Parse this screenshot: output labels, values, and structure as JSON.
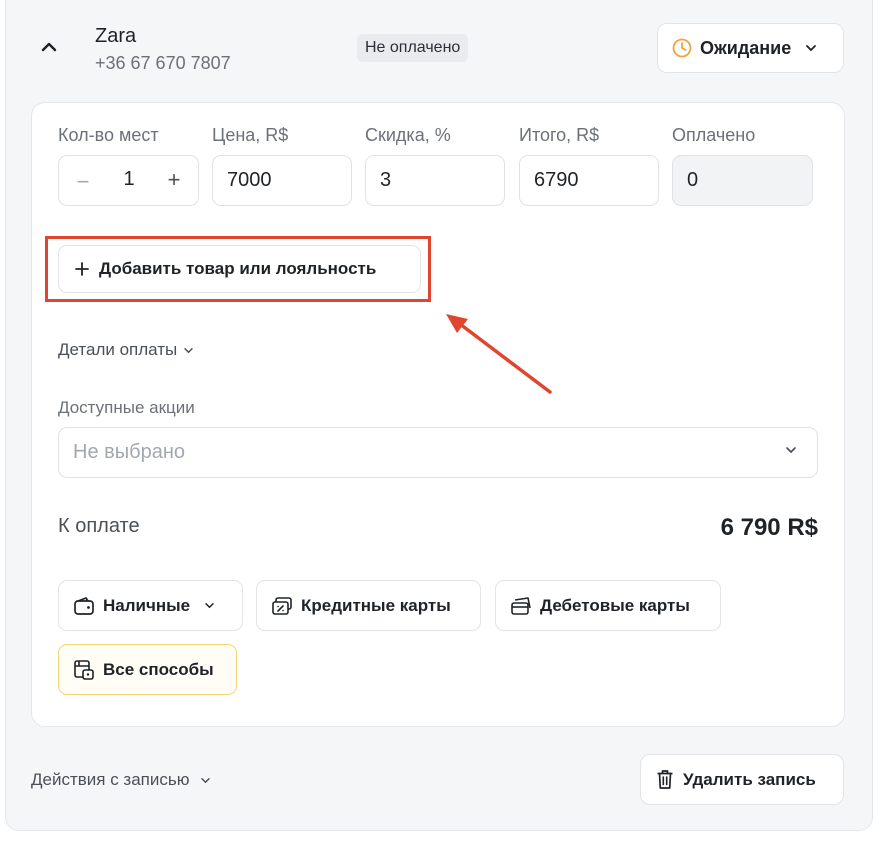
{
  "client": {
    "name": "Zara",
    "phone": "+36 67 670 7807",
    "payment_badge": "Не оплачено",
    "status": "Ожидание",
    "status_icon": "clock-icon",
    "status_color": "#f2a23a"
  },
  "fields": {
    "seats_label": "Кол-во мест",
    "seats_value": "1",
    "price_label": "Цена, R$",
    "price_value": "7000",
    "discount_label": "Скидка, %",
    "discount_value": "3",
    "total_label": "Итого, R$",
    "total_value": "6790",
    "paid_label": "Оплачено",
    "paid_value": "0"
  },
  "add_item": {
    "label": "Добавить товар или лояльность"
  },
  "payment_details": {
    "label": "Детали оплаты"
  },
  "promotions": {
    "label": "Доступные акции",
    "placeholder": "Не выбрано"
  },
  "summary": {
    "to_pay_label": "К оплате",
    "to_pay_value": "6 790 R$"
  },
  "payment_methods": [
    {
      "label": "Наличные",
      "icon": "wallet-icon"
    },
    {
      "label": "Кредитные карты",
      "icon": "credit-card-icon"
    },
    {
      "label": "Дебетовые карты",
      "icon": "debit-card-icon"
    },
    {
      "label": "Все способы",
      "icon": "all-methods-icon"
    }
  ],
  "footer": {
    "record_actions": "Действия с записью",
    "delete_label": "Удалить запись"
  },
  "colors": {
    "highlight": "#e0452f",
    "accent_border": "#f2d675"
  }
}
